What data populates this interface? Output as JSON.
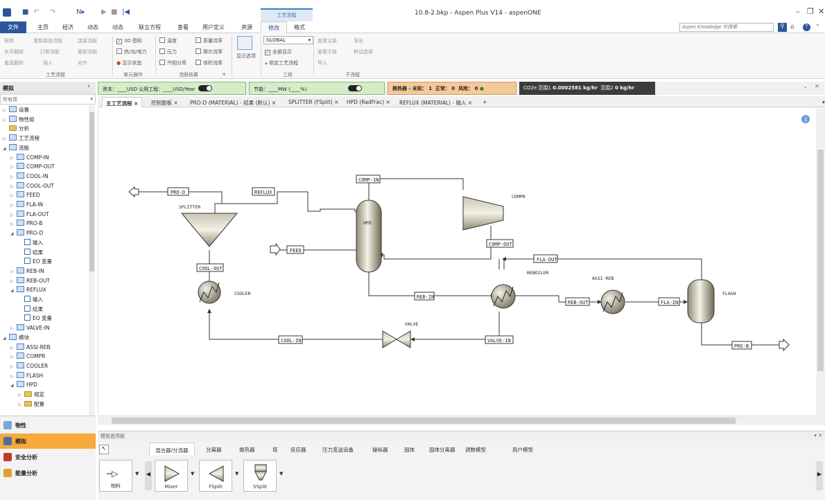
{
  "window": {
    "title": "10.8-2.bkp - Aspen Plus V14 - aspenONE",
    "context_tab": "工艺流程",
    "min": "–",
    "restore": "❐",
    "close": "✕"
  },
  "menu": {
    "file": "文件",
    "home": "主页",
    "economics": "经济",
    "dynamics": "动态",
    "equation": "动态",
    "equation_oriented": "联立方程",
    "view": "查看",
    "custom": "用户定义",
    "resources": "资源",
    "modify": "修改",
    "format": "格式"
  },
  "search": {
    "placeholder": "Aspen Knowledge 中搜索"
  },
  "ribbon": {
    "reconcile": "规转",
    "reroute": "重新路由流股",
    "connect": "连接流股",
    "hflip": "水平翻转",
    "detach": "打断流股",
    "join": "重新流股",
    "vflip": "垂直翻转",
    "insert": "插入",
    "align": "对齐",
    "chk_3d": "3D 图标",
    "chk_heat": "热/功/电力",
    "chk_status": "显示状态",
    "chk_temp": "温度",
    "chk_pressure": "压力",
    "chk_vapor": "汽相分率",
    "chk_mass": "质量流率",
    "chk_mole": "摩尔流率",
    "chk_volume": "体积流率",
    "display_options": "显示选项",
    "global": "GLOBAL",
    "show_all": "全部显示",
    "lock": "锁定工艺流程",
    "view_results": "查看父级",
    "go_up": "查看子级",
    "export": "导出",
    "move_select": "移动选择",
    "import": "导入",
    "grp_flowsheet": "工艺流程",
    "grp_unitops": "单元操作",
    "grp_stream_results": "流股结果",
    "grp_section": "工段",
    "grp_subflow": "子流程"
  },
  "nav": {
    "title": "模拟",
    "collapse": "‹",
    "filter": "所有项",
    "items": [
      {
        "label": "设置",
        "level": 0,
        "arrow": "▷",
        "icon": "fb"
      },
      {
        "label": "物性组",
        "level": 0,
        "arrow": "▷",
        "icon": "fb"
      },
      {
        "label": "分析",
        "level": 0,
        "arrow": "",
        "icon": "fi"
      },
      {
        "label": "工艺流程",
        "level": 0,
        "arrow": "▷",
        "icon": "fb"
      },
      {
        "label": "流股",
        "level": 0,
        "arrow": "◢",
        "icon": "fb"
      },
      {
        "label": "COMP-IN",
        "level": 1,
        "arrow": "▷",
        "icon": "fb"
      },
      {
        "label": "COMP-OUT",
        "level": 1,
        "arrow": "▷",
        "icon": "fb"
      },
      {
        "label": "COOL-IN",
        "level": 1,
        "arrow": "▷",
        "icon": "fb"
      },
      {
        "label": "COOL-OUT",
        "level": 1,
        "arrow": "▷",
        "icon": "fb"
      },
      {
        "label": "FEED",
        "level": 1,
        "arrow": "▷",
        "icon": "fb"
      },
      {
        "label": "FLA-IN",
        "level": 1,
        "arrow": "▷",
        "icon": "fb"
      },
      {
        "label": "FLA-OUT",
        "level": 1,
        "arrow": "▷",
        "icon": "fb"
      },
      {
        "label": "PRO-B",
        "level": 1,
        "arrow": "▷",
        "icon": "fb"
      },
      {
        "label": "PRO-D",
        "level": 1,
        "arrow": "◢",
        "icon": "fb"
      },
      {
        "label": "输入",
        "level": 2,
        "arrow": "",
        "icon": "fc"
      },
      {
        "label": "结果",
        "level": 2,
        "arrow": "",
        "icon": "fc"
      },
      {
        "label": "EO 变量",
        "level": 2,
        "arrow": "",
        "icon": "fc"
      },
      {
        "label": "REB-IN",
        "level": 1,
        "arrow": "▷",
        "icon": "fb"
      },
      {
        "label": "REB-OUT",
        "level": 1,
        "arrow": "▷",
        "icon": "fb"
      },
      {
        "label": "REFLUX",
        "level": 1,
        "arrow": "◢",
        "icon": "fb"
      },
      {
        "label": "输入",
        "level": 2,
        "arrow": "",
        "icon": "fc"
      },
      {
        "label": "结果",
        "level": 2,
        "arrow": "",
        "icon": "fc"
      },
      {
        "label": "EO 变量",
        "level": 2,
        "arrow": "",
        "icon": "fc"
      },
      {
        "label": "VALVE-IN",
        "level": 1,
        "arrow": "▷",
        "icon": "fb"
      },
      {
        "label": "模块",
        "level": 0,
        "arrow": "◢",
        "icon": "fb"
      },
      {
        "label": "ASSI-REB",
        "level": 1,
        "arrow": "▷",
        "icon": "fb"
      },
      {
        "label": "COMPR",
        "level": 1,
        "arrow": "▷",
        "icon": "fb"
      },
      {
        "label": "COOLER",
        "level": 1,
        "arrow": "▷",
        "icon": "fb"
      },
      {
        "label": "FLASH",
        "level": 1,
        "arrow": "▷",
        "icon": "fb"
      },
      {
        "label": "HPD",
        "level": 1,
        "arrow": "◢",
        "icon": "fb"
      },
      {
        "label": "规定",
        "level": 2,
        "arrow": "▷",
        "icon": "fi"
      },
      {
        "label": "配置",
        "level": 2,
        "arrow": "▷",
        "icon": "fi"
      }
    ],
    "bottom": [
      "物性",
      "模拟",
      "安全分析",
      "能量分析"
    ]
  },
  "banner": {
    "capital": "资本：____USD  公用工程：____USD/Year",
    "energy": "节能：____MW  (____%)",
    "hx": "换热器 - 未知：",
    "hx_unknown": "1",
    "hx_ok_label": "正常：",
    "hx_ok": "0",
    "hx_risk_label": "风险：",
    "hx_risk": "0",
    "co2_label": "CO2e 范围1",
    "co2_val": "0.0002581 kg/hr",
    "scope2_label": "范围2",
    "scope2_val": "0 kg/hr"
  },
  "tabs": [
    "主工艺流程",
    "控制面板",
    "PRO-D (MATERIAL) - 结果 (默认)",
    "SPLITTER (FSplit)",
    "HPD (RadFrac)",
    "REFLUX (MATERIAL) - 输入"
  ],
  "flowsheet": {
    "streams": {
      "pro_d": "PRO-D",
      "reflux": "REFLUX",
      "comp_in": "COMP-IN",
      "comp_out": "COMP-OUT",
      "feed": "FEED",
      "fla_out": "FLA-OUT",
      "cool_out": "COOL-OUT",
      "reb_in": "REB-IN",
      "reb_out": "REB-OUT",
      "fla_in": "FLA-IN",
      "cool_in": "COOL-IN",
      "valve_in": "VALVE-IN",
      "pro_b": "PRO-B"
    },
    "blocks": {
      "splitter": "SPLITTER",
      "hpd": "HPD",
      "compr": "COMPR",
      "cooler": "COOLER",
      "reboiler": "REBOILER",
      "assi_reb": "ASSI-REB",
      "flash": "FLASH",
      "valve": "VALVE"
    }
  },
  "palette": {
    "title": "模型选项板",
    "tabs": [
      "混合器/分流器",
      "分离器",
      "换热器",
      "塔",
      "反应器",
      "压力变送设备",
      "操纵器",
      "固体",
      "固体分离器",
      "调数模型",
      "用户模型"
    ],
    "items": [
      "物料",
      "Mixer",
      "FSplit",
      "SSplit"
    ]
  },
  "colors": {
    "file": "#2b579a",
    "sel_nav": "#f7a93a",
    "banner_green": "#d4ecc8",
    "banner_orange": "#f5c99a",
    "banner_dark": "#3c3c3c"
  }
}
